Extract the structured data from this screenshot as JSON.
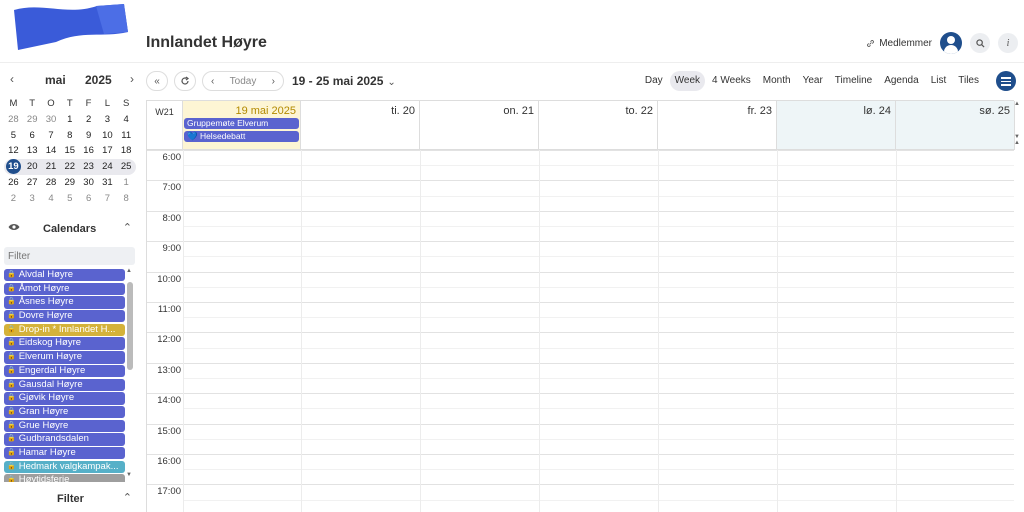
{
  "header": {
    "title": "Innlandet Høyre",
    "members_label": "Medlemmer",
    "icons": [
      "link-icon",
      "avatar",
      "search-icon",
      "info-icon"
    ]
  },
  "mini_calendar": {
    "month": "mai",
    "year": "2025",
    "weekdays": [
      "M",
      "T",
      "O",
      "T",
      "F",
      "L",
      "S"
    ],
    "weeks": [
      [
        "28",
        "29",
        "30",
        "1",
        "2",
        "3",
        "4"
      ],
      [
        "5",
        "6",
        "7",
        "8",
        "9",
        "10",
        "11"
      ],
      [
        "12",
        "13",
        "14",
        "15",
        "16",
        "17",
        "18"
      ],
      [
        "19",
        "20",
        "21",
        "22",
        "23",
        "24",
        "25"
      ],
      [
        "26",
        "27",
        "28",
        "29",
        "30",
        "31",
        "1"
      ],
      [
        "2",
        "3",
        "4",
        "5",
        "6",
        "7",
        "8"
      ]
    ],
    "today": "19"
  },
  "calendars": {
    "title": "Calendars",
    "filter_placeholder": "Filter",
    "items": [
      {
        "label": "Alvdal Høyre",
        "color": "#5a63cf"
      },
      {
        "label": "Åmot Høyre",
        "color": "#5a63cf"
      },
      {
        "label": "Åsnes Høyre",
        "color": "#5a63cf"
      },
      {
        "label": "Dovre Høyre",
        "color": "#5a63cf"
      },
      {
        "label": "Drop-in * Innlandet H...",
        "color": "#d4b23a"
      },
      {
        "label": "Eidskog Høyre",
        "color": "#5a63cf"
      },
      {
        "label": "Elverum Høyre",
        "color": "#5a63cf"
      },
      {
        "label": "Engerdal Høyre",
        "color": "#5a63cf"
      },
      {
        "label": "Gausdal Høyre",
        "color": "#5a63cf"
      },
      {
        "label": "Gjøvik Høyre",
        "color": "#5a63cf"
      },
      {
        "label": "Gran Høyre",
        "color": "#5a63cf"
      },
      {
        "label": "Grue Høyre",
        "color": "#5a63cf"
      },
      {
        "label": "Gudbrandsdalen",
        "color": "#5a63cf"
      },
      {
        "label": "Hamar Høyre",
        "color": "#5a63cf"
      },
      {
        "label": "Hedmark valgkampak...",
        "color": "#56b0c8"
      },
      {
        "label": "Høytidsferie",
        "color": "#9e9e9e"
      }
    ]
  },
  "filter_section": {
    "title": "Filter"
  },
  "toolbar": {
    "today_label": "Today",
    "range": "19 - 25 mai 2025",
    "views": [
      "Day",
      "Week",
      "4 Weeks",
      "Month",
      "Year",
      "Timeline",
      "Agenda",
      "List",
      "Tiles"
    ],
    "active_view": "Week"
  },
  "week": {
    "label": "W21",
    "days": [
      "19 mai 2025",
      "ti. 20",
      "on. 21",
      "to. 22",
      "fr. 23",
      "lø. 24",
      "sø. 25"
    ],
    "hours": [
      "6:00",
      "7:00",
      "8:00",
      "9:00",
      "10:00",
      "11:00",
      "12:00",
      "13:00",
      "14:00",
      "15:00",
      "16:00",
      "17:00"
    ]
  },
  "events": [
    {
      "title": "Gruppemøte Elverum",
      "day": 0
    },
    {
      "title": "💙 Helsedebatt",
      "day": 0
    }
  ],
  "colors": {
    "accent": "#1f4e8c",
    "event": "#5a63cf",
    "today_bg": "#fdf5d4",
    "weekend_bg": "#eef5f7"
  }
}
